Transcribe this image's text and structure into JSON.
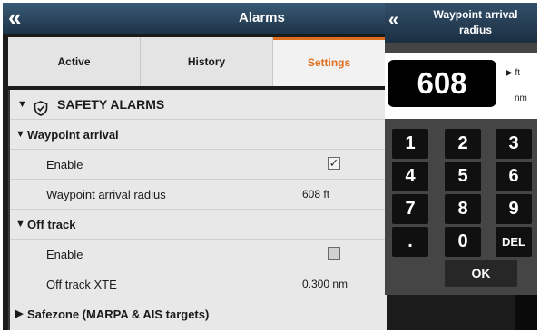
{
  "window": {
    "back_glyph": "«",
    "title": "Alarms"
  },
  "tabs": [
    {
      "label": "Active"
    },
    {
      "label": "History"
    },
    {
      "label": "Settings"
    }
  ],
  "list": {
    "section": "SAFETY ALARMS",
    "section_icon": "shield-check-icon",
    "waypoint_arrival": {
      "header": "Waypoint arrival",
      "enable_label": "Enable",
      "enable_checked": true,
      "radius_label": "Waypoint arrival radius",
      "radius_value": "608 ft"
    },
    "off_track": {
      "header": "Off track",
      "enable_label": "Enable",
      "enable_checked": false,
      "xte_label": "Off track XTE",
      "xte_value": "0.300 nm"
    },
    "safezone": {
      "header": "Safezone (MARPA & AIS targets)"
    },
    "expanded_glyph": "▼",
    "collapsed_glyph": "▶",
    "check_glyph": "✓"
  },
  "keypad_dialog": {
    "back_glyph": "«",
    "title": "Waypoint arrival radius",
    "value": "608",
    "unit_selected_marker": "▶",
    "unit_ft": "ft",
    "unit_nm": "nm",
    "keys": [
      "1",
      "2",
      "3",
      "4",
      "5",
      "6",
      "7",
      "8",
      "9",
      ".",
      "0",
      "DEL"
    ],
    "ok_label": "OK"
  },
  "colors": {
    "accent": "#e07020",
    "titlebar": "#2a475f",
    "list_bg": "#e8e8e8"
  }
}
